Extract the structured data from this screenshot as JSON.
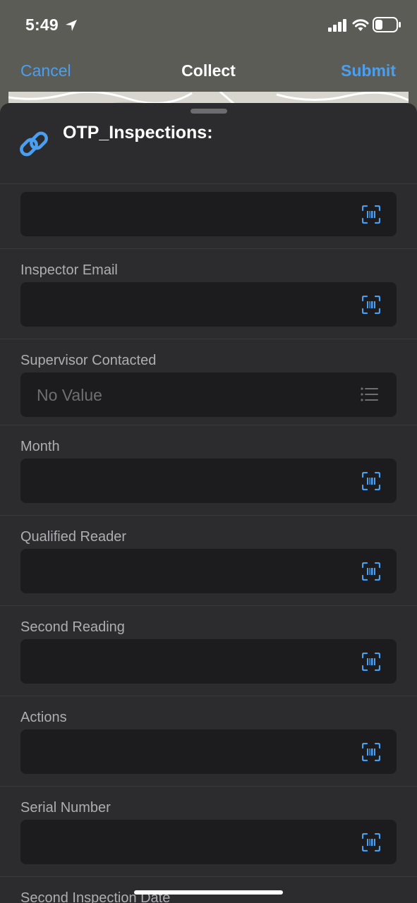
{
  "status_bar": {
    "time": "5:49"
  },
  "nav": {
    "cancel_label": "Cancel",
    "title": "Collect",
    "submit_label": "Submit"
  },
  "sheet": {
    "title": "OTP_Inspections:"
  },
  "fields": [
    {
      "label": "",
      "value": "",
      "type": "text"
    },
    {
      "label": "Inspector Email",
      "value": "",
      "type": "text"
    },
    {
      "label": "Supervisor Contacted",
      "value": "No Value",
      "type": "list"
    },
    {
      "label": "Month",
      "value": "",
      "type": "text"
    },
    {
      "label": "Qualified Reader",
      "value": "",
      "type": "text"
    },
    {
      "label": "Second Reading",
      "value": "",
      "type": "text"
    },
    {
      "label": "Actions",
      "value": "",
      "type": "text"
    },
    {
      "label": "Serial Number",
      "value": "",
      "type": "text"
    },
    {
      "label": "Second Inspection Date",
      "value": "",
      "type": "text"
    }
  ],
  "colors": {
    "accent": "#4a9ff0",
    "sheet_bg": "#2c2c2e",
    "input_bg": "#1c1c1e",
    "label": "#aeaeb2",
    "placeholder": "#6e6e73",
    "nav_bg": "#5b5c56"
  },
  "icons": {
    "link": "link-icon",
    "barcode": "barcode-scan-icon",
    "list": "list-icon",
    "location": "location-arrow-icon",
    "signal": "cellular-signal-icon",
    "wifi": "wifi-icon",
    "battery": "battery-icon"
  }
}
